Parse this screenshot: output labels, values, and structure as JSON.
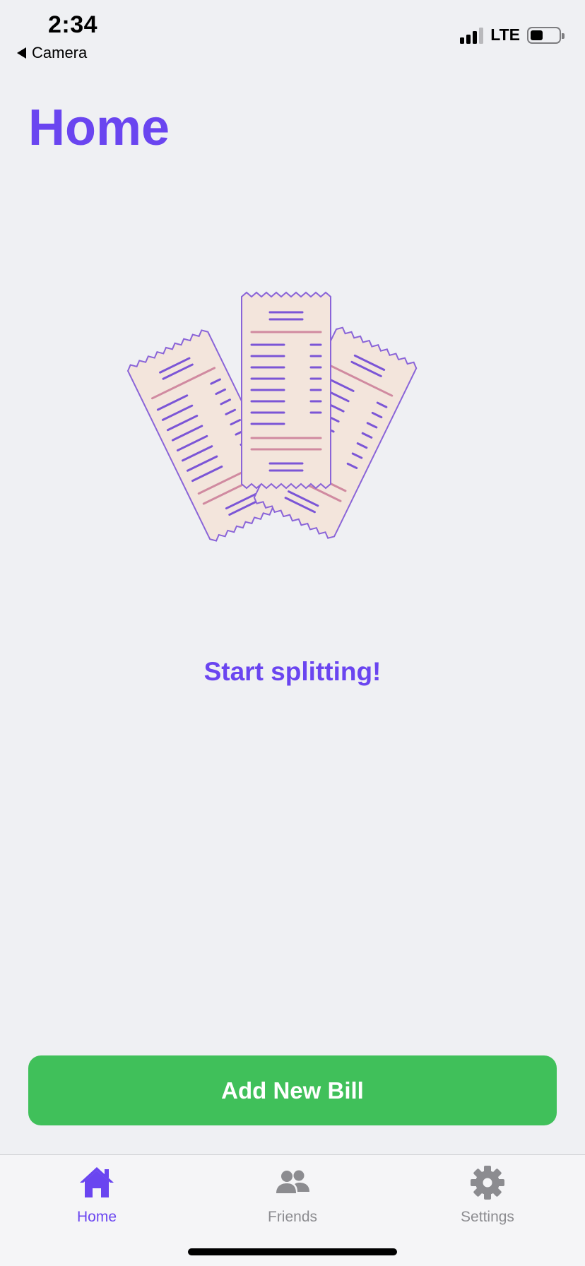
{
  "status_bar": {
    "time": "2:34",
    "back_app": "Camera",
    "network": "LTE",
    "signal_bars_active": 3,
    "signal_bars_total": 4,
    "battery_level": 0.45
  },
  "page": {
    "title": "Home",
    "illustration": "receipts-illustration",
    "tagline": "Start splitting!"
  },
  "primary_action": {
    "label": "Add New Bill",
    "color": "#40c05a"
  },
  "tab_bar": {
    "tabs": [
      {
        "label": "Home",
        "icon": "house-icon",
        "active": true
      },
      {
        "label": "Friends",
        "icon": "people-icon",
        "active": false
      },
      {
        "label": "Settings",
        "icon": "gear-icon",
        "active": false
      }
    ]
  },
  "colors": {
    "accent": "#6a45f0",
    "background": "#eff0f3",
    "inactive": "#8c8c90",
    "receipt_paper": "#f3e5dc",
    "receipt_line": "#7b55d6",
    "receipt_highlight": "#d08aa0"
  }
}
